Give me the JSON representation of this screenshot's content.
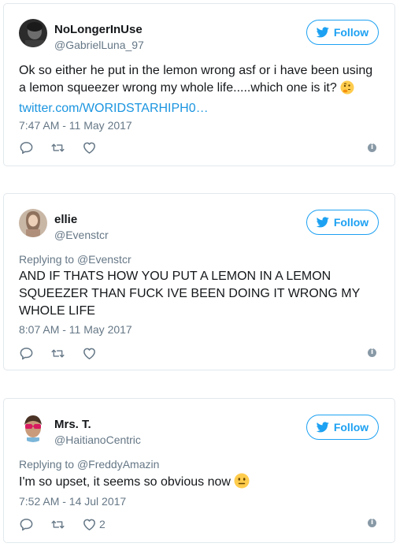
{
  "follow_label": "Follow",
  "colors": {
    "accent": "#1da1f2",
    "link": "#1b95e0",
    "muted": "#657786",
    "border": "#e1e8ed"
  },
  "tweets": [
    {
      "name": "NoLongerInUse",
      "handle": "@GabrielLuna_97",
      "reply_to_prefix": "",
      "reply_to_handle": "",
      "text": "Ok so either he put in the lemon wrong asf or i have been using a lemon squeezer wrong my whole life.....which one is it?",
      "text_emoji": "thinking-face",
      "link": "twitter.com/WORIDSTARHIPH0…",
      "timestamp": "7:47 AM - 11 May 2017",
      "like_count": ""
    },
    {
      "name": "ellie",
      "handle": "@Evenstcr",
      "reply_to_prefix": "Replying to",
      "reply_to_handle": "@Evenstcr",
      "text": "AND IF THATS HOW YOU PUT A LEMON IN A LEMON SQUEEZER THAN FUCK IVE BEEN DOING IT WRONG MY WHOLE LIFE",
      "timestamp": "8:07 AM - 11 May 2017",
      "like_count": ""
    },
    {
      "name": "Mrs. T.",
      "handle": "@HaitianoCentric",
      "reply_to_prefix": "Replying to",
      "reply_to_handle": "@FreddyAmazin",
      "text": "I'm so upset, it seems so obvious now",
      "text_emoji": "neutral-face",
      "timestamp": "7:52 AM - 14 Jul 2017",
      "like_count": "2"
    }
  ]
}
